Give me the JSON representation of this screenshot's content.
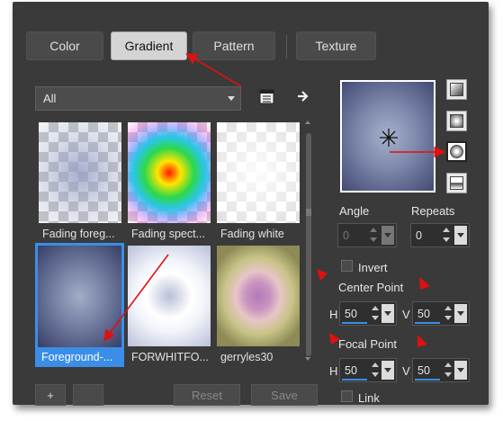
{
  "tabs": [
    {
      "label": "Color"
    },
    {
      "label": "Gradient",
      "active": true
    },
    {
      "label": "Pattern"
    },
    {
      "label": "Texture"
    }
  ],
  "filter": {
    "selected": "All"
  },
  "gradients": [
    {
      "label": "Fading foreg...",
      "style": "fading-foreground"
    },
    {
      "label": "Fading spect...",
      "style": "fading-spectrum"
    },
    {
      "label": "Fading white",
      "style": "fading-white"
    },
    {
      "label": "Foreground-...",
      "style": "foreground-background",
      "selected": true
    },
    {
      "label": "FORWHITFO...",
      "style": "forwhitfo"
    },
    {
      "label": "gerryles30",
      "style": "gerryles30"
    }
  ],
  "angle": {
    "label": "Angle",
    "value": "0"
  },
  "repeats": {
    "label": "Repeats",
    "value": "0"
  },
  "invert": {
    "label": "Invert"
  },
  "center_point": {
    "label": "Center Point",
    "h_label": "H",
    "h_value": "50",
    "v_label": "V",
    "v_value": "50"
  },
  "focal_point": {
    "label": "Focal Point",
    "h_label": "H",
    "h_value": "50",
    "v_label": "V",
    "v_value": "50"
  },
  "link": {
    "label": "Link"
  },
  "buttons": {
    "add": "+",
    "reset": "Reset",
    "save": "Save"
  },
  "colors": {
    "accent": "#3a8ee8",
    "annotation_arrow": "#e01010",
    "panel": "#3a3a3a"
  }
}
